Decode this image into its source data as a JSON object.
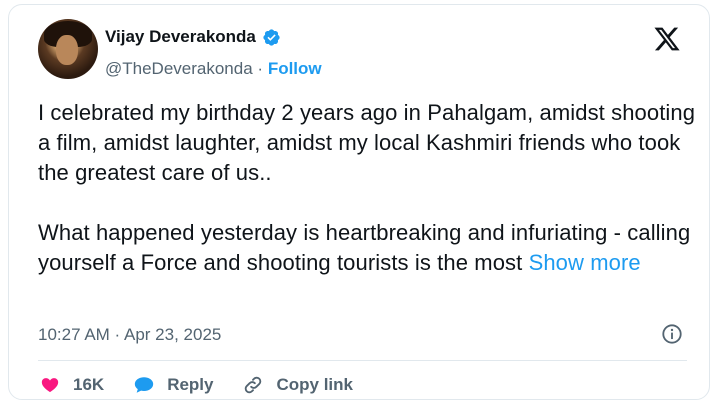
{
  "author": {
    "name": "Vijay Deverakonda",
    "handle": "@TheDeverakonda",
    "separator": "·",
    "follow_label": "Follow"
  },
  "tweet": {
    "paragraph1": "I celebrated my birthday 2 years ago in Pahalgam, amidst shooting a film, amidst laughter, amidst my local Kashmiri friends who took the greatest care of us..",
    "paragraph2": "What happened yesterday is heartbreaking and infuriating - calling yourself a Force and shooting tourists is the most",
    "show_more": "Show more"
  },
  "meta": {
    "timestamp": "10:27 AM · Apr 23, 2025"
  },
  "actions": {
    "likes_count": "16K",
    "reply_label": "Reply",
    "copy_link_label": "Copy link"
  },
  "colors": {
    "accent": "#1d9bf0",
    "like": "#f91880",
    "text_secondary": "#536471"
  },
  "icons": {
    "verified": "verified-badge-icon",
    "logo": "x-logo-icon",
    "info": "info-icon",
    "like": "heart-icon",
    "reply": "speech-bubble-icon",
    "copy": "link-icon"
  }
}
